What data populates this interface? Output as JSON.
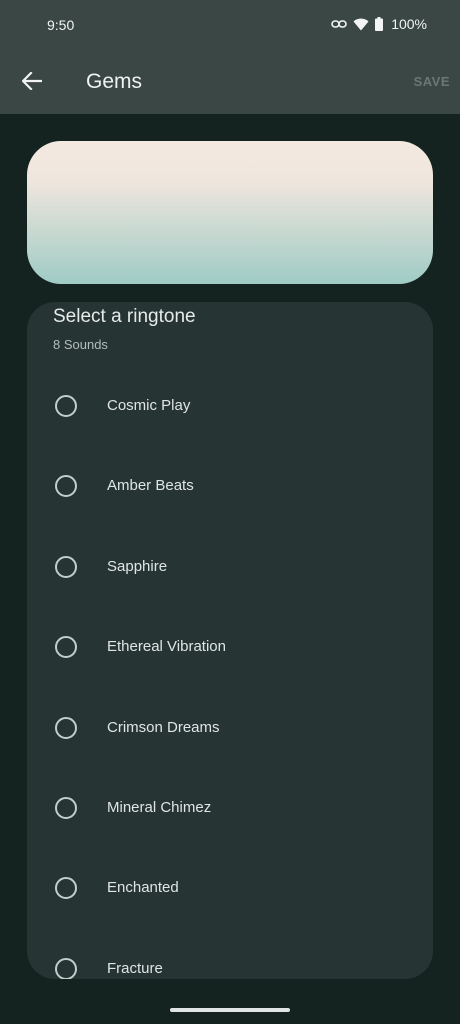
{
  "status_bar": {
    "time": "9:50",
    "battery": "100%",
    "icons": [
      "link-icon",
      "wifi-icon",
      "battery-icon"
    ]
  },
  "app_bar": {
    "title": "Gems",
    "save_label": "SAVE",
    "back_icon": "arrow-back-icon"
  },
  "sheet": {
    "title": "Select a ringtone",
    "subtitle": "8 Sounds",
    "items": [
      {
        "label": "Cosmic Play"
      },
      {
        "label": "Amber Beats"
      },
      {
        "label": "Sapphire"
      },
      {
        "label": "Ethereal Vibration"
      },
      {
        "label": "Crimson Dreams"
      },
      {
        "label": "Mineral Chimez"
      },
      {
        "label": "Enchanted"
      },
      {
        "label": "Fracture"
      }
    ]
  },
  "colors": {
    "background": "#142220",
    "app_bar": "#3a4745",
    "sheet": "#263534",
    "gradient_top": "#f4e9e1",
    "gradient_bottom": "#9fcbc5"
  }
}
